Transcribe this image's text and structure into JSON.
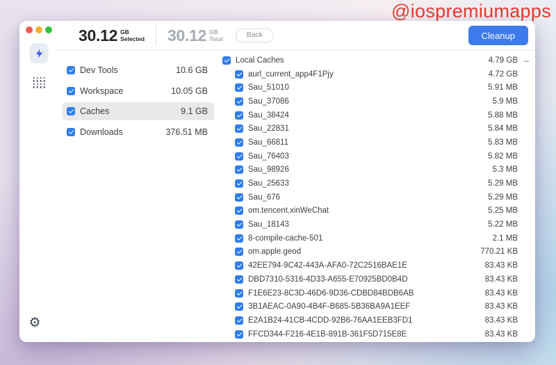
{
  "watermark": "@iospremiumapps",
  "header": {
    "selected": {
      "value": "30.12",
      "unit": "GB",
      "label": "Selected"
    },
    "total": {
      "value": "30.12",
      "unit": "GB",
      "label": "Total"
    },
    "back_label": "Back",
    "cleanup_label": "Cleanup"
  },
  "rail": {
    "icons": [
      "lightning-icon",
      "grid-dots-icon",
      "gear-icon"
    ],
    "gear_glyph": "⚙"
  },
  "categories": [
    {
      "label": "Dev Tools",
      "size": "10.6 GB",
      "checked": true,
      "selected": false
    },
    {
      "label": "Workspace",
      "size": "10.05 GB",
      "checked": true,
      "selected": false
    },
    {
      "label": "Caches",
      "size": "9.1 GB",
      "checked": true,
      "selected": true
    },
    {
      "label": "Downloads",
      "size": "376.51 MB",
      "checked": true,
      "selected": false
    }
  ],
  "files": [
    {
      "name": "Local Caches",
      "size": "4.79 GB",
      "checked": true,
      "indent": 0,
      "collapse": "–"
    },
    {
      "name": "aurl_current_app4F1Pjy",
      "size": "4.72 GB",
      "checked": true,
      "indent": 1
    },
    {
      "name": "Sau_51010",
      "size": "5.91 MB",
      "checked": true,
      "indent": 1
    },
    {
      "name": "Sau_37086",
      "size": "5.9 MB",
      "checked": true,
      "indent": 1
    },
    {
      "name": "Sau_38424",
      "size": "5.88 MB",
      "checked": true,
      "indent": 1
    },
    {
      "name": "Sau_22831",
      "size": "5.84 MB",
      "checked": true,
      "indent": 1
    },
    {
      "name": "Sau_66811",
      "size": "5.83 MB",
      "checked": true,
      "indent": 1
    },
    {
      "name": "Sau_76403",
      "size": "5.82 MB",
      "checked": true,
      "indent": 1
    },
    {
      "name": "Sau_98926",
      "size": "5.3 MB",
      "checked": true,
      "indent": 1
    },
    {
      "name": "Sau_25633",
      "size": "5.29 MB",
      "checked": true,
      "indent": 1
    },
    {
      "name": "Sau_676",
      "size": "5.29 MB",
      "checked": true,
      "indent": 1
    },
    {
      "name": "om.tencent.xinWeChat",
      "size": "5.25 MB",
      "checked": true,
      "indent": 1
    },
    {
      "name": "Sau_18143",
      "size": "5.22 MB",
      "checked": true,
      "indent": 1
    },
    {
      "name": "8-compile-cache-501",
      "size": "2.1 MB",
      "checked": true,
      "indent": 1
    },
    {
      "name": "om.apple.geod",
      "size": "770.21 KB",
      "checked": true,
      "indent": 1
    },
    {
      "name": "42EE794-9C42-443A-AFA0-72C2516BAE1E",
      "size": "83.43 KB",
      "checked": true,
      "indent": 1
    },
    {
      "name": "DBD7310-5316-4D33-A655-E70925BD0B4D",
      "size": "83.43 KB",
      "checked": true,
      "indent": 1
    },
    {
      "name": "F1E6E23-8C3D-46D6-9D36-CDBD84BDB6AB",
      "size": "83.43 KB",
      "checked": true,
      "indent": 1
    },
    {
      "name": "3B1AEAC-0A90-4B4F-B685-5B36BA9A1EEF",
      "size": "83.43 KB",
      "checked": true,
      "indent": 1
    },
    {
      "name": "E2A1B24-41CB-4CDD-92B6-76AA1EEB3FD1",
      "size": "83.43 KB",
      "checked": true,
      "indent": 1
    },
    {
      "name": "FFCD344-F216-4E1B-891B-361F5D715E8E",
      "size": "83.43 KB",
      "checked": true,
      "indent": 1
    }
  ],
  "colors": {
    "accent_button": "#3d7bed",
    "checkbox": "#2f7ced",
    "watermark": "#e93a2b",
    "selected_row_highlight": "#e9e9eb",
    "traffic_red": "#f05a4f",
    "traffic_yellow": "#f6b02e",
    "traffic_green": "#2fc33c"
  }
}
